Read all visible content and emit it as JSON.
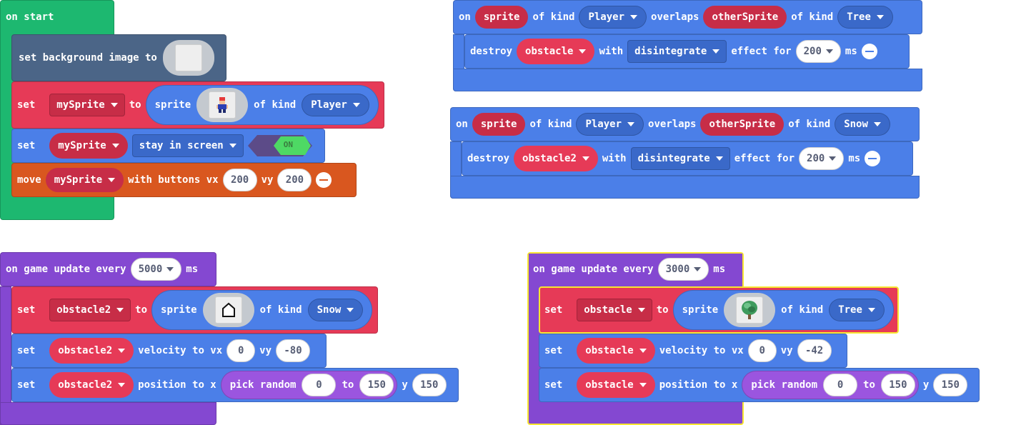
{
  "on_start": {
    "header": "on start",
    "set_bg": {
      "label": "set background image to"
    },
    "set_sprite": {
      "set": "set",
      "var": "mySprite",
      "to": "to",
      "sprite": "sprite",
      "of_kind": "of kind",
      "kind": "Player"
    },
    "stay": {
      "set": "set",
      "var": "mySprite",
      "option": "stay in screen",
      "toggle": "ON"
    },
    "move": {
      "move": "move",
      "var": "mySprite",
      "with": "with buttons vx",
      "vx": "200",
      "vy_label": "vy",
      "vy": "200"
    }
  },
  "overlap_tree": {
    "on": "on",
    "sprite": "sprite",
    "of_kind": "of kind",
    "kind": "Player",
    "overlaps": "overlaps",
    "other": "otherSprite",
    "of_kind2": "of kind",
    "kind2": "Tree",
    "destroy": "destroy",
    "target": "obstacle",
    "with": "with",
    "effect": "disintegrate",
    "effect_for": "effect for",
    "ms_value": "200",
    "ms": "ms"
  },
  "overlap_snow": {
    "on": "on",
    "sprite": "sprite",
    "of_kind": "of kind",
    "kind": "Player",
    "overlaps": "overlaps",
    "other": "otherSprite",
    "of_kind2": "of kind",
    "kind2": "Snow",
    "destroy": "destroy",
    "target": "obstacle2",
    "with": "with",
    "effect": "disintegrate",
    "effect_for": "effect for",
    "ms_value": "200",
    "ms": "ms"
  },
  "update_snow": {
    "header": "on game update every",
    "interval": "5000",
    "ms": "ms",
    "set1": {
      "set": "set",
      "var": "obstacle2",
      "to": "to",
      "sprite": "sprite",
      "of_kind": "of kind",
      "kind": "Snow"
    },
    "set2": {
      "set": "set",
      "var": "obstacle2",
      "label": "velocity to vx",
      "vx": "0",
      "vy_label": "vy",
      "vy": "-80"
    },
    "set3": {
      "set": "set",
      "var": "obstacle2",
      "label": "position to x",
      "pick": "pick random",
      "from": "0",
      "to": "to",
      "max": "150",
      "y_label": "y",
      "y": "150"
    }
  },
  "update_tree": {
    "header": "on game update every",
    "interval": "3000",
    "ms": "ms",
    "set1": {
      "set": "set",
      "var": "obstacle",
      "to": "to",
      "sprite": "sprite",
      "of_kind": "of kind",
      "kind": "Tree"
    },
    "set2": {
      "set": "set",
      "var": "obstacle",
      "label": "velocity to vx",
      "vx": "0",
      "vy_label": "vy",
      "vy": "-42"
    },
    "set3": {
      "set": "set",
      "var": "obstacle",
      "label": "position to x",
      "pick": "pick random",
      "from": "0",
      "to": "to",
      "max": "150",
      "y_label": "y",
      "y": "150"
    }
  },
  "colors": {
    "loops": "#1db870",
    "scene": "#4b6587",
    "sprites": "#e63a57",
    "events": "#4b7fe8",
    "controller": "#d9571f",
    "game": "#8448d1",
    "math": "#9b55df",
    "selected_outline": "#f7e631"
  }
}
